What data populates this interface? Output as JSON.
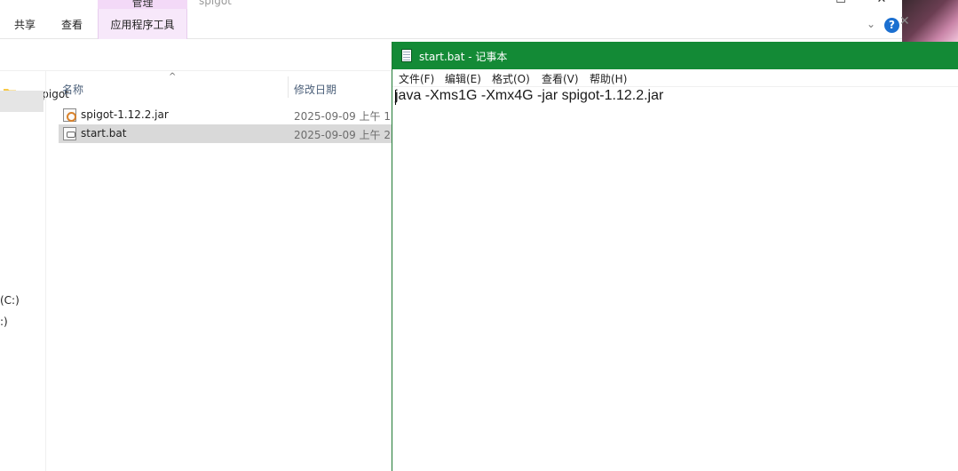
{
  "explorer": {
    "context_tab_title": "管理",
    "window_title": "spigot",
    "window_controls": {
      "minimize": "—",
      "maximize": "☐",
      "close": "✕"
    },
    "ribbon_tabs": [
      "共享",
      "查看",
      "应用程序工具"
    ],
    "address": {
      "crumb": "spigot"
    },
    "nav_items": [
      "(C:)",
      ":)"
    ],
    "columns": {
      "name": "名称",
      "modified": "修改日期"
    },
    "files": [
      {
        "name": "spigot-1.12.2.jar",
        "date": "2025-09-09 上午 1:",
        "icon": "jar-file-icon",
        "selected": false
      },
      {
        "name": "start.bat",
        "date": "2025-09-09 上午 2:",
        "icon": "bat-file-icon",
        "selected": true
      }
    ],
    "help_label": "?"
  },
  "notepad": {
    "title": "start.bat - 记事本",
    "menu": [
      "文件(F)",
      "编辑(E)",
      "格式(O)",
      "查看(V)",
      "帮助(H)"
    ],
    "content": "java -Xms1G -Xmx4G -jar spigot-1.12.2.jar",
    "titlebar_color": "#138a36"
  }
}
